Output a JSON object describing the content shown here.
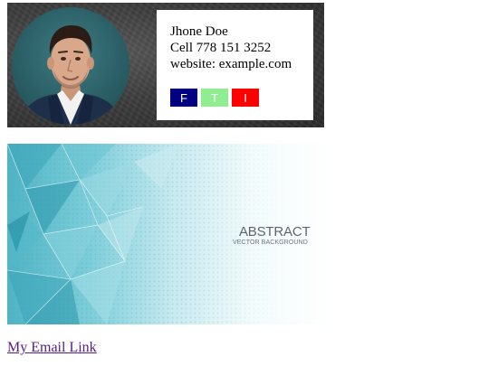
{
  "signature": {
    "name": "Jhone Doe",
    "cell": "Cell 778 151 3252",
    "website": "website: example.com",
    "avatar_icon": "person-photo-icon",
    "social": [
      {
        "label": "F",
        "color": "#000080",
        "icon": "facebook-icon"
      },
      {
        "label": "T",
        "color": "#90ee90",
        "icon": "twitter-icon"
      },
      {
        "label": "I",
        "color": "#ff0000",
        "icon": "instagram-icon"
      }
    ]
  },
  "banner": {
    "title": "ABSTRACT",
    "subtitle": "VECTOR BACKGROUND",
    "accent_color": "#5fbfce"
  },
  "link": {
    "text": "My Email Link",
    "color": "#551a8b"
  }
}
